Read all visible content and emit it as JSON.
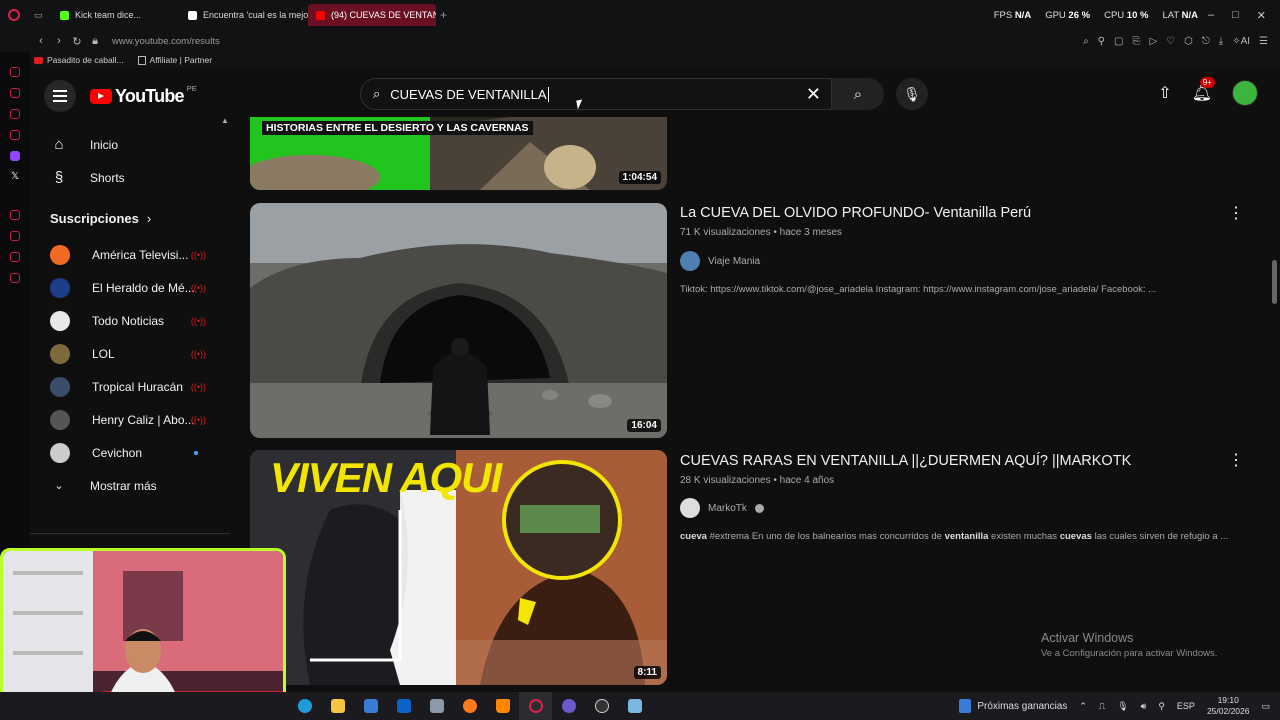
{
  "browser": {
    "tabs": [
      {
        "label": "Kick team dice...",
        "color": "#53fc18"
      },
      {
        "label": "Encuentra 'cual es la mejo",
        "color": "#ffffff"
      },
      {
        "label": "(94) CUEVAS DE VENTANI",
        "color": "#ff0000",
        "active": true
      }
    ],
    "perf": [
      {
        "label": "FPS",
        "value": "N/A"
      },
      {
        "label": "GPU",
        "value": "26 %"
      },
      {
        "label": "CPU",
        "value": "10 %"
      },
      {
        "label": "LAT",
        "value": "N/A"
      }
    ],
    "url": "www.youtube.com/results",
    "bookmarks": [
      "Pasadito de caball...",
      "Affiliate | Partner"
    ]
  },
  "youtube": {
    "logo_text": "YouTube",
    "country": "PE",
    "search_value": "CUEVAS DE VENTANILLA",
    "notif_count": "9+"
  },
  "sidebar": {
    "main": [
      {
        "label": "Inicio",
        "icon": "home-icon"
      },
      {
        "label": "Shorts",
        "icon": "shorts-icon"
      }
    ],
    "subs_title": "Suscripciones",
    "channels": [
      {
        "label": "América Televisi...",
        "color": "#f26a21",
        "status": "live"
      },
      {
        "label": "El Heraldo de Mé...",
        "color": "#1d3f8a",
        "status": "live"
      },
      {
        "label": "Todo Noticias",
        "color": "#e8e8e8",
        "status": "live"
      },
      {
        "label": "LOL",
        "color": "#7c6a3a",
        "status": "live"
      },
      {
        "label": "Tropical Huracán",
        "color": "#3a4d6a",
        "status": "live"
      },
      {
        "label": "Henry Caliz | Abo...",
        "color": "#555555",
        "status": "live"
      },
      {
        "label": "Cevichon",
        "color": "#cccccc",
        "status": "new"
      }
    ],
    "show_more": "Mostrar más"
  },
  "results": [
    {
      "title": "",
      "thumb_text": "HISTORIAS ENTRE EL DESIERTO Y LAS CAVERNAS",
      "duration": "1:04:54"
    },
    {
      "title": "La CUEVA DEL OLVIDO PROFUNDO- Ventanilla Perú",
      "views": "71 K visualizaciones",
      "age": "hace 3 meses",
      "channel": "Viaje Mania",
      "verified": false,
      "description": "Tiktok: https://www.tiktok.com/@jose_ariadela Instagram: https://www.instagram.com/jose_ariadela/ Facebook: ...",
      "duration": "16:04"
    },
    {
      "title": "CUEVAS RARAS EN VENTANILLA ||¿DUERMEN AQUÍ? ||MARKOTK",
      "views": "28 K visualizaciones",
      "age": "hace 4 años",
      "channel": "MarkoTk",
      "verified": true,
      "description_parts": [
        "cueva",
        " #extrema En uno de los balnearios mas concurridos de ",
        "ventanilla",
        " existen muchas ",
        "cuevas",
        " las cuales sirven de refugio a ..."
      ],
      "thumb_text": "VIVEN AQUI",
      "duration": "8:11"
    }
  ],
  "watermark": {
    "line1": "Activar Windows",
    "line2": "Ve a Configuración para activar Windows."
  },
  "taskbar": {
    "news": "Próximas ganancias",
    "lang": "ESP",
    "time": "19:10",
    "date": "25/02/2026"
  }
}
